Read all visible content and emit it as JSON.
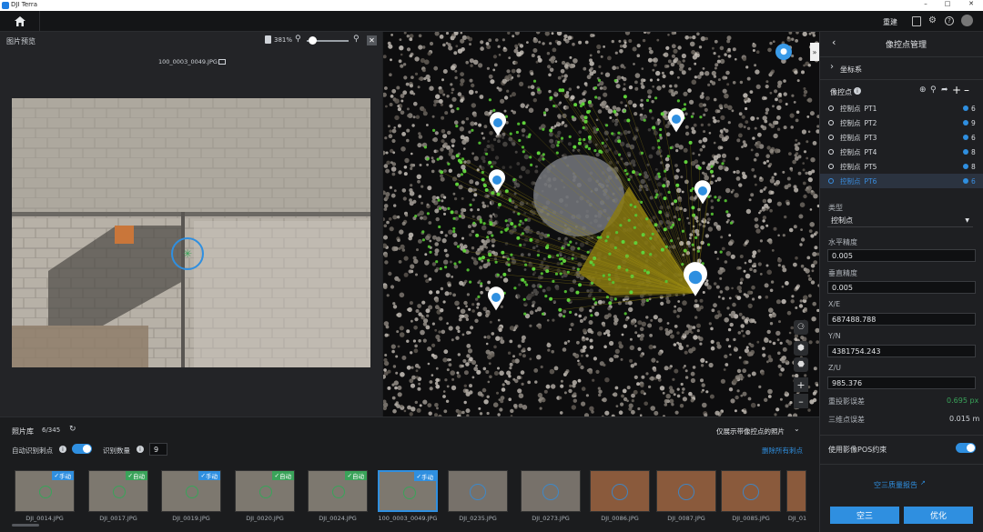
{
  "app": {
    "title": "DJI Terra"
  },
  "appbar": {
    "rebuild": "重建"
  },
  "preview": {
    "title": "图片预览",
    "zoom": "381%",
    "filename": "100_0003_0049.JPG"
  },
  "library": {
    "title": "照片库",
    "count": "6/345",
    "auto_label": "自动识别刺点",
    "recog_label": "识别数量",
    "recog_value": "9",
    "filter": "仅展示带像控点的照片",
    "delete_all": "删除所有刺点",
    "thumbs": [
      {
        "name": "DJI_0014.JPG",
        "badge": "手动",
        "badge_color": "#2f8fe0"
      },
      {
        "name": "DJI_0017.JPG",
        "badge": "自动",
        "badge_color": "#3aa35a"
      },
      {
        "name": "DJI_0019.JPG",
        "badge": "手动",
        "badge_color": "#2f8fe0"
      },
      {
        "name": "DJI_0020.JPG",
        "badge": "自动",
        "badge_color": "#3aa35a"
      },
      {
        "name": "DJI_0024.JPG",
        "badge": "自动",
        "badge_color": "#3aa35a"
      },
      {
        "name": "100_0003_0049.JPG",
        "badge": "手动",
        "badge_color": "#2f8fe0"
      },
      {
        "name": "DJI_0235.JPG",
        "badge": "",
        "badge_color": ""
      },
      {
        "name": "DJI_0273.JPG",
        "badge": "",
        "badge_color": ""
      },
      {
        "name": "DJI_0086.JPG",
        "badge": "",
        "badge_color": ""
      },
      {
        "name": "DJI_0087.JPG",
        "badge": "",
        "badge_color": ""
      },
      {
        "name": "DJI_0085.JPG",
        "badge": "",
        "badge_color": ""
      },
      {
        "name": "DJI_01",
        "badge": "",
        "badge_color": ""
      }
    ]
  },
  "panel": {
    "title": "像控点管理",
    "coord": "坐标系",
    "gcp_header": "像控点",
    "points": [
      {
        "type": "控制点",
        "name": "PT1",
        "count": "6"
      },
      {
        "type": "控制点",
        "name": "PT2",
        "count": "9"
      },
      {
        "type": "控制点",
        "name": "PT3",
        "count": "6"
      },
      {
        "type": "控制点",
        "name": "PT4",
        "count": "8"
      },
      {
        "type": "控制点",
        "name": "PT5",
        "count": "8"
      },
      {
        "type": "控制点",
        "name": "PT6",
        "count": "6"
      }
    ],
    "type_label": "类型",
    "type_value": "控制点",
    "h_acc_label": "水平精度",
    "h_acc": "0.005",
    "v_acc_label": "垂直精度",
    "v_acc": "0.005",
    "x_label": "X/E",
    "x": "687488.788",
    "y_label": "Y/N",
    "y": "4381754.243",
    "z_label": "Z/U",
    "z": "985.376",
    "reproj_label": "重投影误差",
    "reproj": "0.695 px",
    "tri_label": "三维点误差",
    "tri": "0.015 m",
    "pos_label": "使用影像POS约束",
    "report": "空三质量报告",
    "at_btn": "空三",
    "opt_btn": "优化"
  },
  "colors": {
    "accent": "#2f8fe0",
    "auto": "#3aa35a"
  }
}
